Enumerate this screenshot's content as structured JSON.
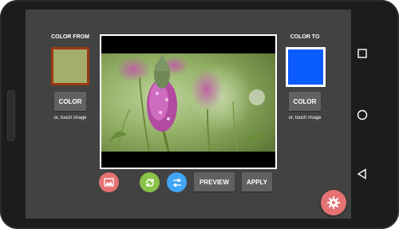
{
  "color_from": {
    "label": "COLOR FROM",
    "swatch_fill": "#a3ad6c",
    "swatch_border": "#9c3a12",
    "button_label": "COLOR",
    "hint": "or, touch image"
  },
  "color_to": {
    "label": "COLOR TO",
    "swatch_fill": "#0a5cff",
    "swatch_border": "#ffffff",
    "button_label": "COLOR",
    "hint": "or, touch image"
  },
  "toolbar": {
    "gallery_icon": "image-icon",
    "gallery_color": "#e57373",
    "refresh_icon": "refresh-icon",
    "refresh_color": "#8bc34a",
    "adjust_icon": "sliders-icon",
    "adjust_color": "#42a5f5",
    "preview_label": "PREVIEW",
    "apply_label": "APPLY"
  },
  "settings_fab": {
    "icon": "gear-icon",
    "color": "#e57373"
  },
  "navigation": {
    "recents_icon": "square-icon",
    "home_icon": "circle-icon",
    "back_icon": "triangle-icon"
  },
  "image": {
    "description_icon": "flower-photo"
  }
}
